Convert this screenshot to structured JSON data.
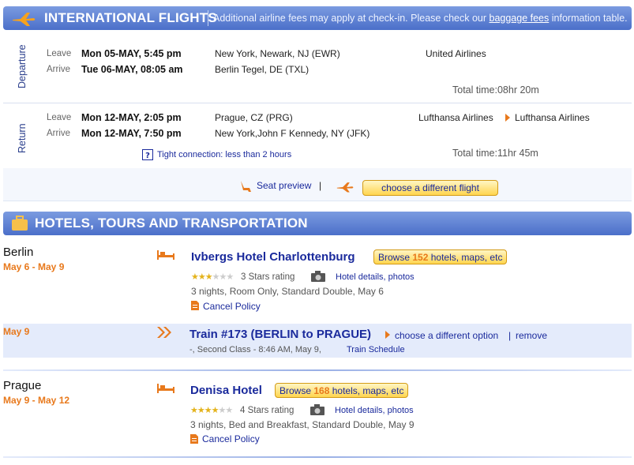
{
  "flights": {
    "title": "INTERNATIONAL FLIGHTS",
    "note_prefix": "Additional airline fees may apply at check-in. Please check our",
    "note_link": "baggage fees",
    "note_suffix": "information table.",
    "departure": {
      "label": "Departure",
      "leave_label": "Leave",
      "leave_dt": "Mon 05-MAY, 5:45 pm",
      "leave_place": "New York, Newark, NJ (EWR)",
      "airline": "United Airlines",
      "arrive_label": "Arrive",
      "arrive_dt": "Tue 06-MAY, 08:05 am",
      "arrive_place": "Berlin Tegel, DE (TXL)",
      "total_time": "Total time:08hr 20m"
    },
    "return": {
      "label": "Return",
      "leave_label": "Leave",
      "leave_dt": "Mon 12-MAY, 2:05 pm",
      "leave_place": "Prague, CZ (PRG)",
      "airline_1": "Lufthansa Airlines",
      "airline_2": "Lufthansa Airlines",
      "arrive_label": "Arrive",
      "arrive_dt": "Mon 12-MAY, 7:50 pm",
      "arrive_place": "New York,John F Kennedy, NY (JFK)",
      "tight_connection": "Tight connection: less than 2 hours",
      "total_time": "Total time:11hr 45m"
    },
    "seat_preview": "Seat preview",
    "separator": "|",
    "choose_flight": "choose a different flight"
  },
  "hotels": {
    "title": "HOTELS, TOURS AND TRANSPORTATION",
    "berlin": {
      "city": "Berlin",
      "dates": "May 6 - May 9",
      "hotel": "Ivbergs Hotel Charlottenburg",
      "browse_prefix": "Browse",
      "browse_count": "152",
      "browse_suffix": "hotels, maps, etc",
      "rating": "3 Stars rating",
      "details": "Hotel details, photos",
      "info": "3 nights, Room Only, Standard Double, May 6",
      "cancel": "Cancel Policy"
    },
    "train": {
      "date": "May 9",
      "title": "Train #173 (BERLIN to PRAGUE)",
      "choose": "choose a different option",
      "sep": "|",
      "remove": "remove",
      "info": "-, Second Class - 8:46 AM, May 9,",
      "schedule": "Train Schedule"
    },
    "prague": {
      "city": "Prague",
      "dates": "May 9 - May 12",
      "hotel": "Denisa Hotel",
      "browse_prefix": "Browse",
      "browse_count": "168",
      "browse_suffix": "hotels, maps, etc",
      "rating": "4 Stars rating",
      "details": "Hotel details, photos",
      "info": "3 nights, Bed and Breakfast, Standard Double, May 9",
      "cancel": "Cancel Policy"
    }
  },
  "colors": {
    "accent": "#e8791c",
    "link": "#1a2a9c",
    "band": "#5b7fd4"
  }
}
